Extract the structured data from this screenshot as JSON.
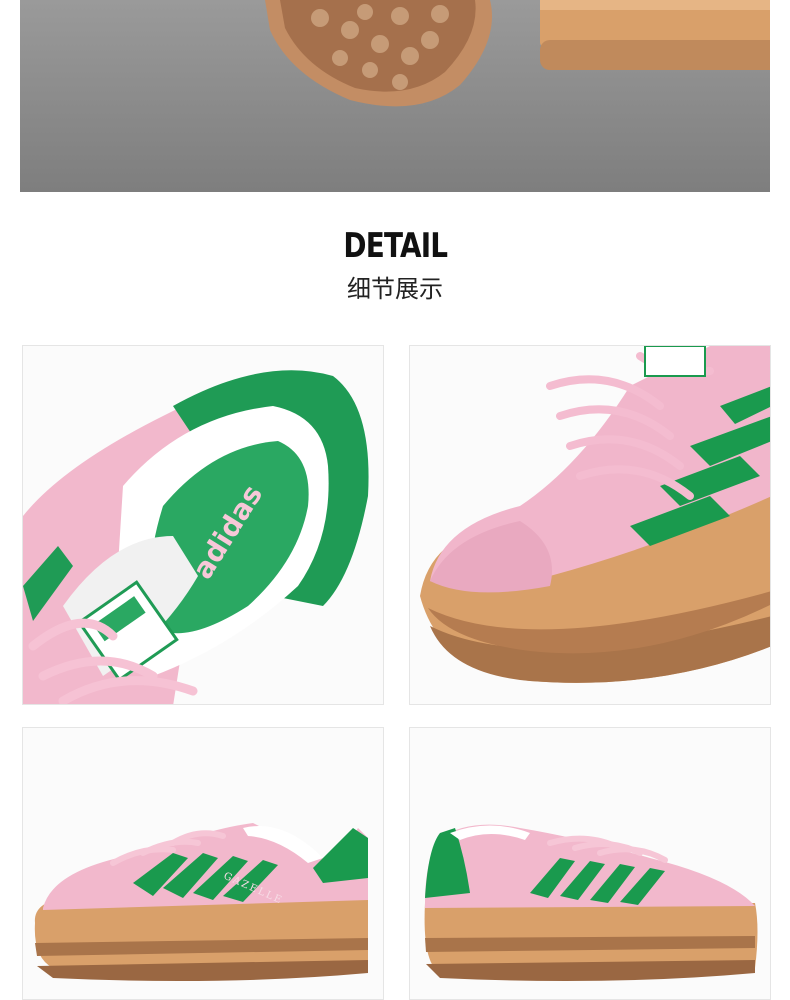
{
  "section": {
    "title_en": "DETAIL",
    "title_cn": "细节展示"
  },
  "brand": {
    "name": "adidas",
    "model": "GAZELLE"
  },
  "colors": {
    "suede_pink": "#f2b8cc",
    "stripe_green": "#1a9a4e",
    "gum_sole": "#d9a06a",
    "gum_dark": "#a9744a",
    "floor": "#8a8a8a"
  }
}
